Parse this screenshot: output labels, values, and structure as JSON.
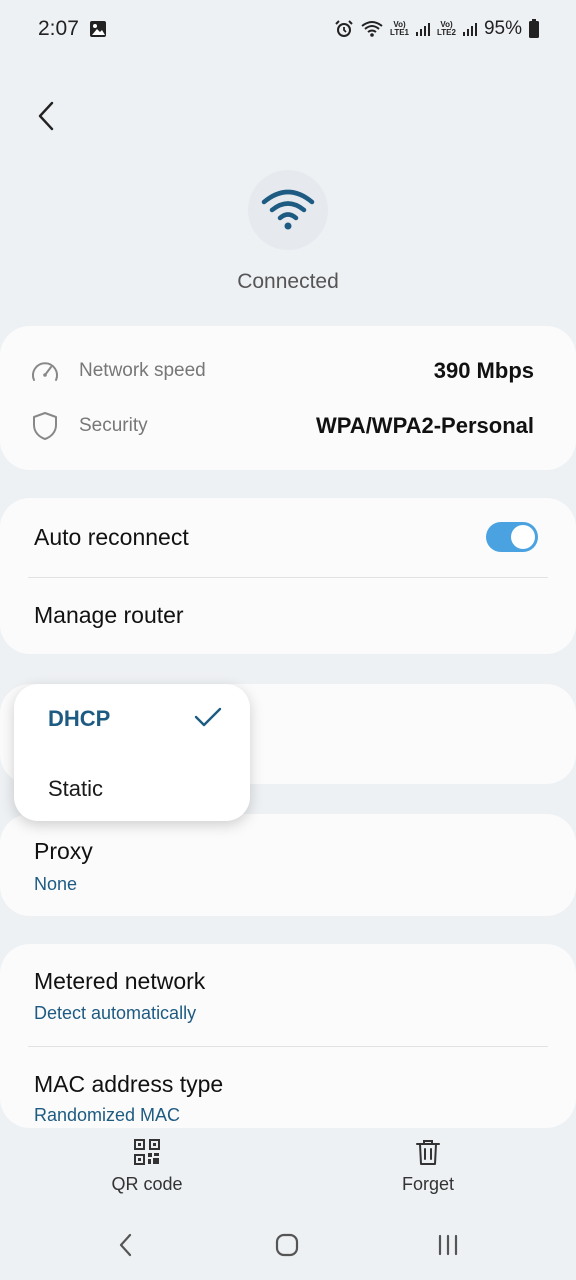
{
  "status_bar": {
    "time": "2:07",
    "battery": "95%",
    "lte1": [
      "Vo)",
      "LTE1"
    ],
    "lte2": [
      "Vo)",
      "LTE2"
    ]
  },
  "header": {
    "status": "Connected"
  },
  "info_card": {
    "speed_label": "Network speed",
    "speed_value": "390 Mbps",
    "security_label": "Security",
    "security_value": "WPA/WPA2-Personal"
  },
  "settings_card": {
    "auto_reconnect_label": "Auto reconnect",
    "auto_reconnect_enabled": true,
    "manage_router_label": "Manage router"
  },
  "ip_popup": {
    "options": [
      "DHCP",
      "Static"
    ],
    "selected": "DHCP"
  },
  "proxy_card": {
    "label": "Proxy",
    "value": "None"
  },
  "advanced_card": {
    "metered_label": "Metered network",
    "metered_value": "Detect automatically",
    "mac_label": "MAC address type",
    "mac_value": "Randomized MAC"
  },
  "bottom_actions": {
    "qr_label": "QR code",
    "forget_label": "Forget"
  },
  "colors": {
    "accent": "#1e5b82",
    "toggle": "#4aa3e0",
    "background": "#eef1f4",
    "card": "#fbfbfb"
  },
  "icons": [
    "gallery-icon",
    "alarm-icon",
    "wifi-status-icon",
    "signal-icon",
    "battery-icon",
    "back-arrow-icon",
    "wifi-icon",
    "speedometer-icon",
    "shield-icon",
    "checkmark-icon",
    "qr-code-icon",
    "trash-icon",
    "nav-back-icon",
    "nav-home-icon",
    "nav-recents-icon"
  ]
}
